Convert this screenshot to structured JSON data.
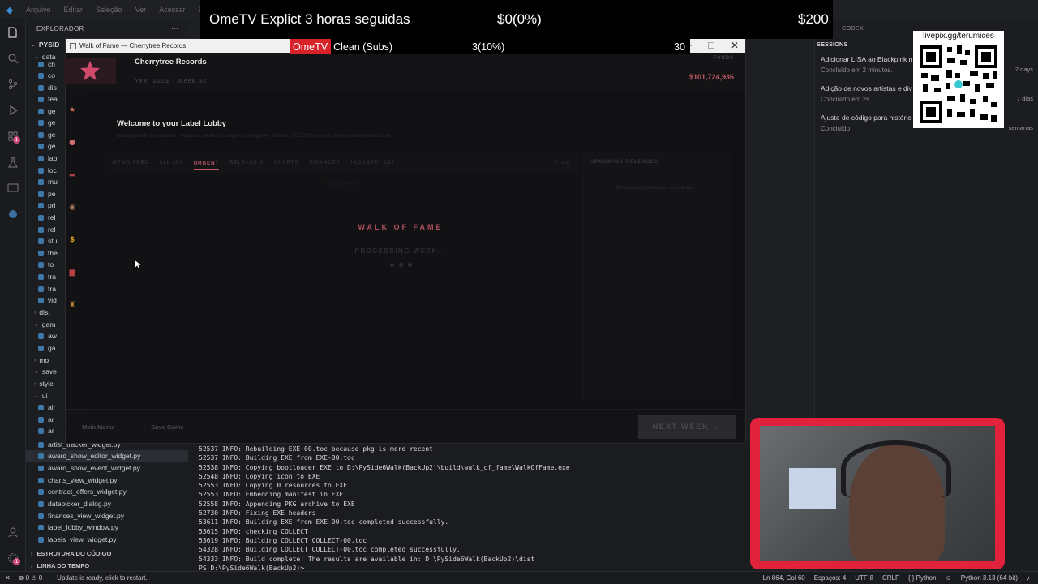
{
  "vscode": {
    "menu": [
      "Arquivo",
      "Editar",
      "Seleção",
      "Ver",
      "Acessar",
      "Executar"
    ],
    "explorer_title": "EXPLORADOR",
    "tree_top": [
      "PYSID",
      "data",
      "ch",
      "co",
      "dis",
      "fea",
      "ge",
      "ge",
      "ge",
      "ge",
      "lab",
      "loc",
      "mu",
      "pe",
      "pri",
      "rel",
      "rel",
      "stu",
      "the",
      "to",
      "tra",
      "tra",
      "vid",
      "dist",
      "gam",
      "aw",
      "ga",
      "mo",
      "save",
      "style",
      "ui",
      "air",
      "ar",
      "ar"
    ],
    "tree_files": [
      "artist_tracker_widget.py",
      "award_show_editor_widget.py",
      "award_show_event_widget.py",
      "charts_view_widget.py",
      "contract_offers_widget.py",
      "datepicker_dialog.py",
      "finances_view_widget.py",
      "label_lobby_window.py",
      "labels_view_widget.py"
    ],
    "section_outline": "ESTRUTURA DO CÓDIGO",
    "section_timeline": "LINHA DO TEMPO",
    "terminal_lines": [
      "52537 INFO: Rebuilding EXE-00.toc because pkg is more recent",
      "52537 INFO: Building EXE from EXE-00.toc",
      "52538 INFO: Copying bootloader EXE to D:\\PySide6Walk(BackUp2)\\build\\walk_of_fame\\WalkOfFame.exe",
      "52548 INFO: Copying icon to EXE",
      "52553 INFO: Copying 0 resources to EXE",
      "52553 INFO: Embedding manifest in EXE",
      "52558 INFO: Appending PKG archive to EXE",
      "52730 INFO: Fixing EXE headers",
      "53611 INFO: Building EXE from EXE-00.toc completed successfully.",
      "53615 INFO: checking COLLECT",
      "53619 INFO: Building COLLECT COLLECT-00.toc",
      "54328 INFO: Building COLLECT COLLECT-00.toc completed successfully.",
      "54333 INFO: Build complete! The results are available in: D:\\PySide6Walk(BackUp2)\\dist",
      "PS D:\\PySide6Walk(BackUp2)> "
    ],
    "status": {
      "errors": "0",
      "warnings": "0",
      "update": "Update is ready, click to restart.",
      "position": "Ln 864, Col 60",
      "spaces": "Espaços: 4",
      "encoding": "UTF-8",
      "eol": "CRLF",
      "language": "Python",
      "interpreter": "Python 3.13 (64-bit)"
    }
  },
  "codex": {
    "title": "CODEX",
    "sessions_title": "SESSIONS",
    "sessions": [
      {
        "title": "Adicionar LISA ao Blackpink n",
        "status": "Concluído em 2 minutos.",
        "time": "2 days"
      },
      {
        "title": "Adição de novos artistas e div",
        "status": "Concluído em 2s.",
        "time": "7 dias"
      },
      {
        "title": "Ajuste de código para históric",
        "status": "Concluído",
        "time": "semanas"
      }
    ]
  },
  "overlay": {
    "goal1_name": "OmeTV Explict 3 horas seguidas",
    "goal1_progress": "$0(0%)",
    "goal1_target": "$200",
    "goal2_brand": "OmeTV",
    "goal2_name": "Clean (Subs)",
    "goal2_progress": "3(10%)",
    "goal2_target": "30",
    "qr_label": "livepix.gg/terumices"
  },
  "game": {
    "window_title": "Walk of Fame — Cherrytree Records",
    "label_name": "Cherrytree Records",
    "year_week": "Year 2023  ·  Week 52",
    "funds_label": "FUNDS",
    "funds_value": "$101,724,936",
    "welcome": "Welcome to your Label Lobby",
    "welcome_sub": "Navigate with the sidebar  ·  Advance weeks to progress the game  ·  Check URGENT news for time-sensitive decisions",
    "tabs": [
      "NEWS FEED",
      "ALL  300",
      "URGENT",
      "RELEASE  3",
      "CHARTS",
      "FINANCES",
      "INDUSTRY  293"
    ],
    "active_tab": "URGENT",
    "tab_right": "Clear",
    "feed_empty": "No urgent items",
    "upcoming_title": "UPCOMING RELEASES",
    "upcoming_empty": "No upcoming releases scheduled.",
    "loading_title": "WALK OF FAME",
    "loading_sub": "PROCESSING WEEK...",
    "btn_main_menu": "Main Menu",
    "btn_save": "Save Game",
    "btn_next_week": "NEXT WEEK  →",
    "nav_icons": [
      "star-icon",
      "microphone-icon",
      "album-icon",
      "disc-icon",
      "dollar-icon",
      "building-icon",
      "trophy-icon"
    ]
  },
  "colors": {
    "accent": "#c45a6a",
    "overlay_red": "#d8222a",
    "webcam_border": "#e0223a"
  }
}
